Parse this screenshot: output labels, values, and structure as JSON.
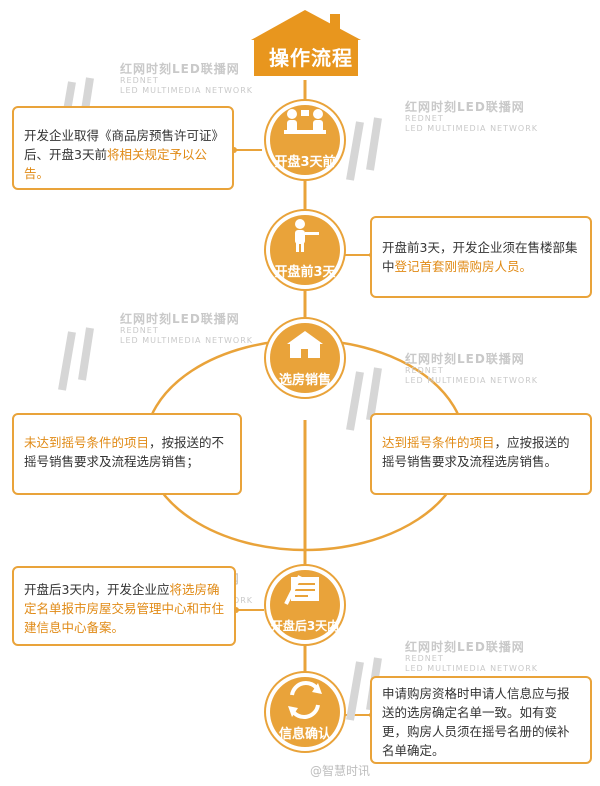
{
  "header": {
    "title": "操作流程"
  },
  "steps": [
    {
      "label": "开盘3天前",
      "icon": "people-meeting-icon"
    },
    {
      "label": "开盘前3天",
      "icon": "person-pointing-icon"
    },
    {
      "label": "选房销售",
      "icon": "house-icon"
    },
    {
      "label": "开盘后3天内",
      "icon": "document-pen-icon"
    },
    {
      "label": "信息确认",
      "icon": "refresh-arrows-icon"
    }
  ],
  "boxes": {
    "b1": {
      "pre": "开发企业取得《商品房预售许可证》后、开盘3天前",
      "hl": "将相关规定予以公告。"
    },
    "b2": {
      "pre": "开盘前3天，开发企业须在售楼部集中",
      "hl": "登记首套刚需购房人员。"
    },
    "b3": {
      "hl": "未达到摇号条件的项目",
      "post": "，按报送的不摇号销售要求及流程选房销售；"
    },
    "b4": {
      "hl": "达到摇号条件的项目",
      "post": "，应按报送的摇号销售要求及流程选房销售。"
    },
    "b5": {
      "pre": "开盘后3天内，开发企业应",
      "hl": "将选房确定名单报市房屋交易管理中心和市住建信息中心备案。"
    },
    "b6": {
      "text": "申请购房资格时申请人信息应与报送的选房确定名单一致。如有变更，购房人员须在摇号名册的候补名单确定。"
    }
  },
  "watermark": {
    "line1": "红网时刻LED联播网",
    "line2": "REDNET",
    "line3": "LED MULTIMEDIA NETWORK"
  },
  "footer": "@智慧时讯",
  "colors": {
    "accent": "#e9a33a",
    "header_bg": "#e8961e",
    "text_highlight": "#e08a15"
  }
}
